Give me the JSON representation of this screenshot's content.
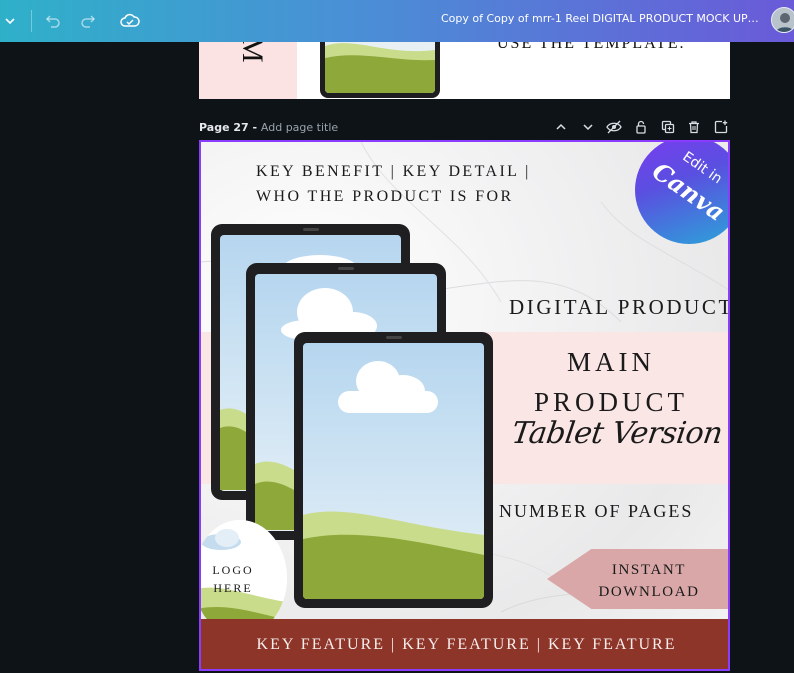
{
  "topbar": {
    "document_title": "Copy of Copy of mrr-1 Reel DIGITAL PRODUCT MOCK UP LI..."
  },
  "previous_page": {
    "side_text": "M",
    "text_fragment": "USE THE TEMPLATE."
  },
  "page_header": {
    "page_number": "Page 27",
    "separator": " - ",
    "title_placeholder": "Add page title"
  },
  "design": {
    "subtitle_line1": "KEY BENEFIT | KEY DETAIL |",
    "subtitle_line2": "WHO THE PRODUCT IS FOR",
    "badge_top": "Edit in",
    "badge_brand": "Canva",
    "digital_product": "DIGITAL PRODUCT",
    "main_line1": "MAIN",
    "main_line2": "PRODUCT",
    "script_text": "Tablet Version",
    "pages_text": "NUMBER OF PAGES",
    "cta_line1": "INSTANT",
    "cta_line2": "DOWNLOAD",
    "logo_line1": "LOGO",
    "logo_line2": "HERE",
    "bottom_text": "KEY FEATURE | KEY FEATURE | KEY FEATURE"
  },
  "colors": {
    "topbar_start": "#2fb0c9",
    "topbar_end": "#6a5ad8",
    "selection_border": "#8b3dff",
    "pink_band": "#fbe6e6",
    "bottom_bar": "#8e3529",
    "cta_arrow": "#d9a7a7"
  },
  "icons": {
    "menu": "chevron-down-icon",
    "undo": "undo-icon",
    "redo": "redo-icon",
    "save_status": "cloud-check-icon",
    "page_tools": [
      "chevron-up-icon",
      "chevron-down-icon",
      "hide-eye-icon",
      "lock-icon",
      "duplicate-icon",
      "trash-icon",
      "add-page-icon"
    ]
  }
}
